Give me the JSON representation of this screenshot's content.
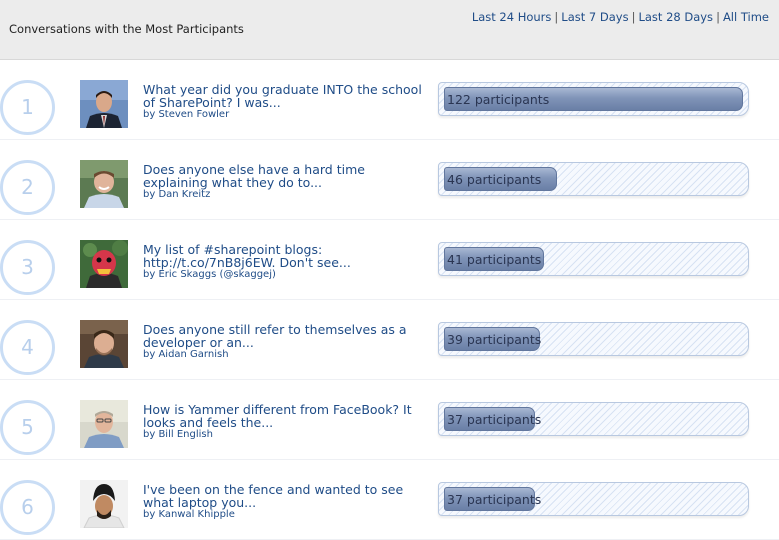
{
  "header": {
    "title": "Conversations with the Most Participants",
    "timeframes": [
      "Last 24 Hours",
      "Last 7 Days",
      "Last 28 Days",
      "All Time"
    ],
    "separator": "|"
  },
  "conversations": [
    {
      "rank": "1",
      "title": "What year did you graduate INTO the school of SharePoint? I was...",
      "author": "by Steven Fowler",
      "participants_label": "122 participants",
      "participants": 122,
      "avatar": "avatar-steven-fowler"
    },
    {
      "rank": "2",
      "title": "Does anyone else have a hard time explaining what they do to...",
      "author": "by Dan Kreitz",
      "participants_label": "46 participants",
      "participants": 46,
      "avatar": "avatar-dan-kreitz"
    },
    {
      "rank": "3",
      "title": "My list of #sharepoint blogs: http://t.co/7nB8j6EW. Don't see...",
      "author": "by Eric Skaggs (@skaggej)",
      "participants_label": "41 participants",
      "participants": 41,
      "avatar": "avatar-eric-skaggs"
    },
    {
      "rank": "4",
      "title": "Does anyone still refer to themselves as a developer or an...",
      "author": "by Aidan Garnish",
      "participants_label": "39 participants",
      "participants": 39,
      "avatar": "avatar-aidan-garnish"
    },
    {
      "rank": "5",
      "title": "How is Yammer different from FaceBook? It looks and feels the...",
      "author": "by Bill English",
      "participants_label": "37 participants",
      "participants": 37,
      "avatar": "avatar-bill-english"
    },
    {
      "rank": "6",
      "title": "I've been on the fence and wanted to see what laptop you...",
      "author": "by Kanwal Khipple",
      "participants_label": "37 participants",
      "participants": 37,
      "avatar": "avatar-kanwal-khipple"
    }
  ],
  "colors": {
    "link": "#1f4c87",
    "bar_fill": "#7d91b5",
    "rank_circle": "#c9ddf5",
    "header_bg": "#ececec"
  }
}
